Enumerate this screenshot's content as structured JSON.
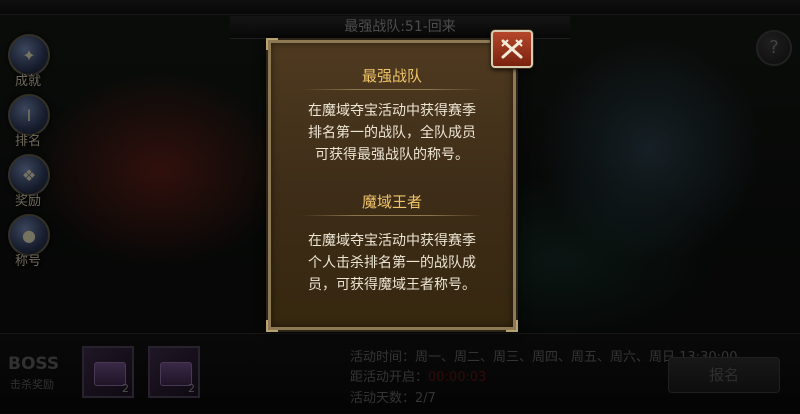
{
  "top_banner": {
    "text": "最强战队:51-回来"
  },
  "side_menu": [
    {
      "label": "成就",
      "icon": "achievement-badge-icon",
      "glyph": "✦"
    },
    {
      "label": "排名",
      "icon": "trophy-icon",
      "glyph": "Ⅰ"
    },
    {
      "label": "奖励",
      "icon": "reward-crest-icon",
      "glyph": "❖"
    },
    {
      "label": "称号",
      "icon": "orb-title-icon",
      "glyph": "●"
    }
  ],
  "help": {
    "glyph": "?"
  },
  "modal": {
    "sections": [
      {
        "title": "最强战队",
        "lines": [
          "在魔域夺宝活动中获得赛季",
          "排名第一的战队，全队成员",
          "可获得最强战队的称号。"
        ]
      },
      {
        "title": "魔域王者",
        "lines": [
          "在魔域夺宝活动中获得赛季",
          "个人击杀排名第一的战队成",
          "员，可获得魔域王者称号。"
        ]
      }
    ]
  },
  "bottom": {
    "boss_title": "BOSS",
    "boss_sub": "击杀奖励",
    "rewards": [
      {
        "count": "2"
      },
      {
        "count": "2"
      }
    ],
    "activity_time_label": "活动时间：",
    "activity_time_value": "周一、周二、周三、周四、周五、周六、周日 13:30:00-",
    "countdown_label": "距活动开启：",
    "countdown_value": "00:00:03",
    "days_label": "活动天数：",
    "days_value": "2/7",
    "signup_label": "报名"
  },
  "colors": {
    "modal_bg": "#4f3a20",
    "modal_border": "#8d7a55",
    "title_gold": "#f0c46a",
    "close_red": "#b5462a"
  }
}
